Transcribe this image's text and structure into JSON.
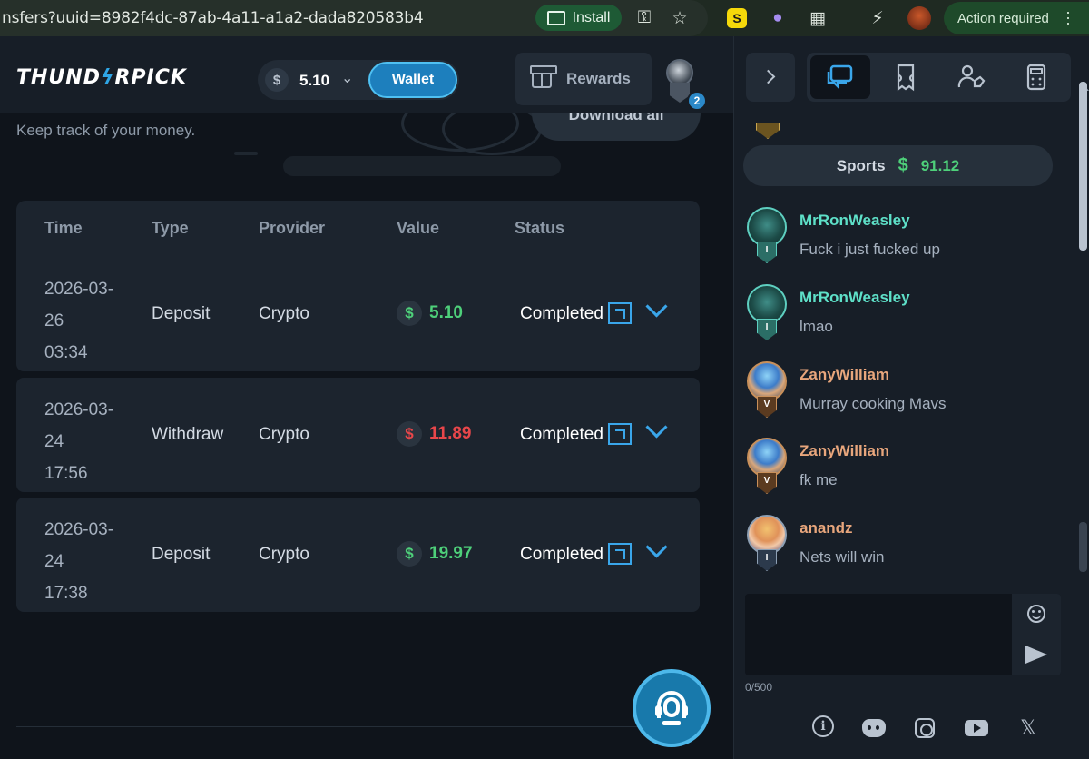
{
  "browser": {
    "url": "nsfers?uuid=8982f4dc-87ab-4a11-a1a2-dada820583b4",
    "install_label": "Install",
    "action_label": "Action required"
  },
  "header": {
    "logo_text_1": "THUND",
    "logo_bolt": "ϟ",
    "logo_text_2": "RPICK",
    "currency_symbol": "$",
    "balance": "5.10",
    "wallet_label": "Wallet",
    "rewards_label": "Rewards",
    "notification_count": "2"
  },
  "page": {
    "subtitle": "Keep track of your money.",
    "download_label": "Download all"
  },
  "table": {
    "columns": [
      "Time",
      "Type",
      "Provider",
      "Value",
      "Status"
    ],
    "rows": [
      {
        "date": "2026-03-",
        "day": "26",
        "time": "03:34",
        "type": "Deposit",
        "provider": "Crypto",
        "value": "5.10",
        "status": "Completed"
      },
      {
        "date": "2026-03-",
        "day": "24",
        "time": "17:56",
        "type": "Withdraw",
        "provider": "Crypto",
        "value": "11.89",
        "status": "Completed"
      },
      {
        "date": "2026-03-",
        "day": "24",
        "time": "17:38",
        "type": "Deposit",
        "provider": "Crypto",
        "value": "19.97",
        "status": "Completed"
      }
    ]
  },
  "chat": {
    "sports_label": "Sports",
    "sports_currency": "$",
    "sports_value": "91.12",
    "messages": [
      {
        "user": "MrRonWeasley",
        "text": "Fuck i just fucked up",
        "rank": "I"
      },
      {
        "user": "MrRonWeasley",
        "text": "lmao",
        "rank": "I"
      },
      {
        "user": "ZanyWilliam",
        "text": "Murray cooking Mavs",
        "rank": "V"
      },
      {
        "user": "ZanyWilliam",
        "text": "fk me",
        "rank": "V"
      },
      {
        "user": "anandz",
        "text": "Nets will win",
        "rank": "I"
      }
    ],
    "char_count": "0/500"
  },
  "colors": {
    "accent": "#2fa6e6",
    "positive": "#4ed07a",
    "negative": "#e8464a",
    "background": "#0f141b"
  },
  "icons": {
    "tabs": [
      "chat-icon",
      "ticket-icon",
      "user-tag-icon",
      "calculator-icon"
    ],
    "social": [
      "info-icon",
      "discord-icon",
      "instagram-icon",
      "youtube-icon",
      "x-icon"
    ]
  }
}
